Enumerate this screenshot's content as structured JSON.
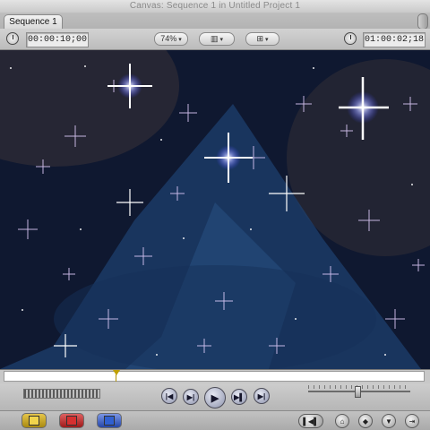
{
  "window": {
    "title": "Canvas: Sequence 1 in Untitled Project 1"
  },
  "tabs": [
    {
      "label": "Sequence 1",
      "active": true
    }
  ],
  "toolbar": {
    "duration_timecode": "00:00:10;00",
    "zoom": "74%",
    "current_timecode": "01:00:02;18"
  },
  "icons": {
    "duration": "clock-icon",
    "current": "clock-icon",
    "view": "view-options-icon",
    "overlay": "overlay-icon",
    "go_prev_edit": "go-to-previous-edit-icon",
    "play_in_to_out": "play-in-to-out-icon",
    "play": "play-icon",
    "play_around": "play-around-current-icon",
    "go_next_edit": "go-to-next-edit-icon",
    "insert": "insert-edit-icon",
    "overwrite": "overwrite-edit-icon",
    "replace": "replace-edit-icon",
    "match_frame": "match-frame-icon",
    "mark_clip": "mark-clip-icon",
    "add_keyframe": "add-keyframe-icon",
    "add_marker": "add-marker-icon",
    "add_motion": "add-motion-keyframe-icon"
  },
  "colors": {
    "playhead": "#c0a000",
    "insert": "#d8b400",
    "overwrite": "#c42828",
    "replace": "#2f58c8"
  },
  "scrubber": {
    "position": 0.27
  },
  "jog": {
    "position": 0.47
  }
}
